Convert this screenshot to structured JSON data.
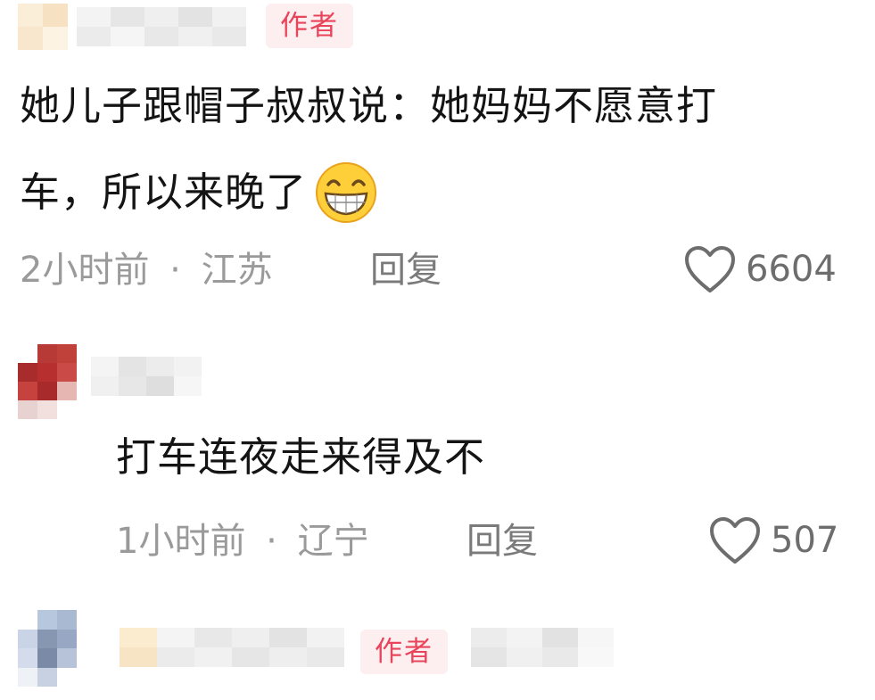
{
  "comments": [
    {
      "author_tag": "作者",
      "text_line1": "她儿子跟帽子叔叔说：她妈妈不愿意打",
      "text_line2": "车，所以来晚了",
      "emoji": "grinning-face-icon",
      "time": "2小时前",
      "location": "江苏",
      "separator": "·",
      "reply_label": "回复",
      "likes": "6604"
    },
    {
      "text_line1": "打车连夜走来得及不",
      "time": "1小时前",
      "location": "辽宁",
      "separator": "·",
      "reply_label": "回复",
      "likes": "507"
    },
    {
      "author_tag": "作者"
    }
  ],
  "colors": {
    "author_tag_bg": "#fdeef0",
    "author_tag_text": "#e8455b",
    "meta_text": "#9a9a9a",
    "body_text": "#141414"
  }
}
